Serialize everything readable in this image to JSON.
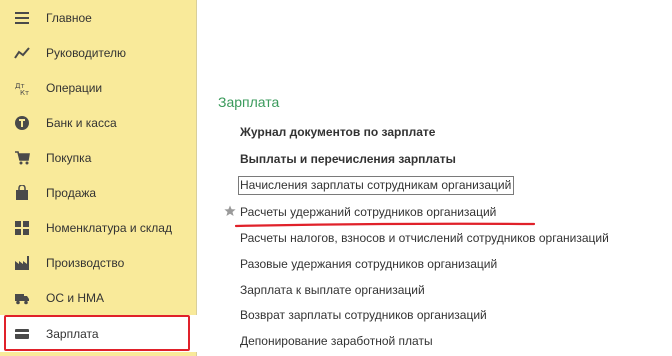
{
  "sidebar": {
    "items": [
      {
        "label": "Главное",
        "icon": "menu-lines-icon"
      },
      {
        "label": "Руководителю",
        "icon": "chart-icon"
      },
      {
        "label": "Операции",
        "icon": "dt-kt-icon"
      },
      {
        "label": "Банк и касса",
        "icon": "coin-icon"
      },
      {
        "label": "Покупка",
        "icon": "cart-icon"
      },
      {
        "label": "Продажа",
        "icon": "bag-icon"
      },
      {
        "label": "Номенклатура и склад",
        "icon": "grid-icon"
      },
      {
        "label": "Производство",
        "icon": "factory-icon"
      },
      {
        "label": "ОС и НМА",
        "icon": "truck-icon"
      },
      {
        "label": "Зарплата",
        "icon": "wallet-icon"
      }
    ]
  },
  "main": {
    "section_title": "Зарплата",
    "links": [
      {
        "label": "Журнал документов по зарплате"
      },
      {
        "label": "Выплаты и перечисления зарплаты"
      },
      {
        "label": "Начисления зарплаты сотрудникам организаций"
      },
      {
        "label": "Расчеты удержаний сотрудников организаций"
      },
      {
        "label": "Расчеты налогов, взносов и отчислений сотрудников организаций"
      },
      {
        "label": "Разовые удержания сотрудников организаций"
      },
      {
        "label": "Зарплата к выплате организаций"
      },
      {
        "label": "Возврат зарплаты сотрудников организаций"
      },
      {
        "label": "Депонирование заработной платы"
      }
    ]
  },
  "colors": {
    "sidebar_bg": "#f9ea9a",
    "section_title": "#3a9a5b",
    "highlight_red": "#e0212a",
    "star_gray": "#9a9a9a"
  }
}
